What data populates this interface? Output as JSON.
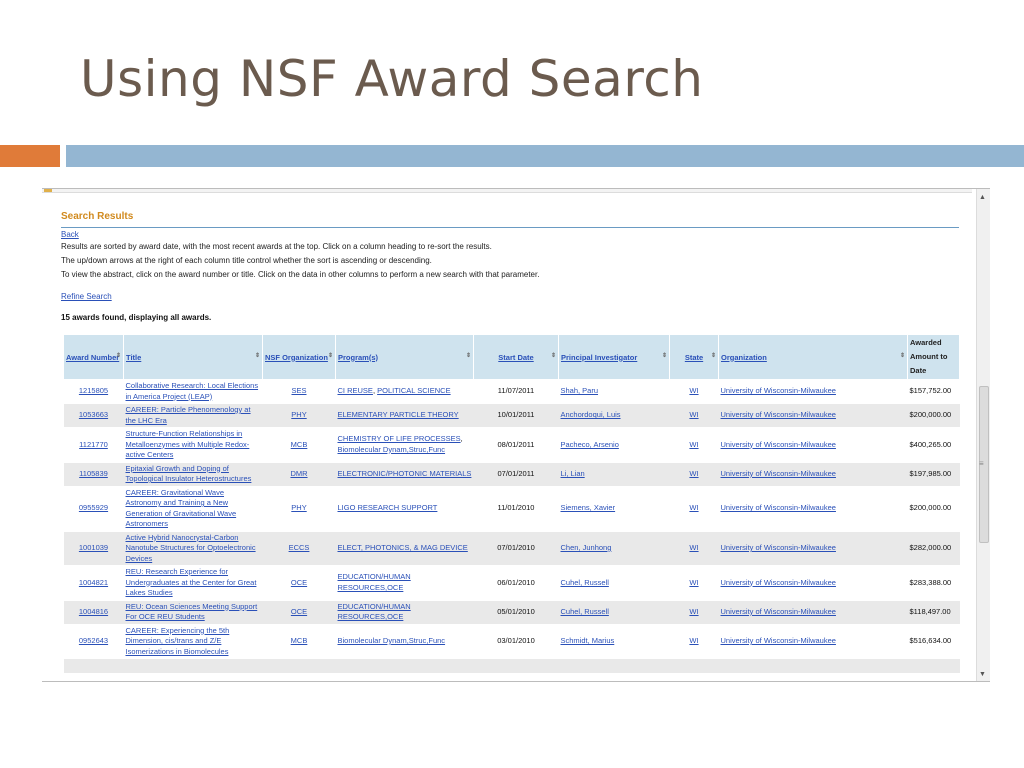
{
  "slide": {
    "title": "Using NSF Award Search"
  },
  "colors": {
    "title": "#6b5b4e",
    "accent_orange": "#e07b39",
    "accent_blue": "#94b6d2",
    "link": "#2a50b8",
    "heading": "#d18a1e"
  },
  "page": {
    "heading": "Search Results",
    "back_label": "Back",
    "info_lines": [
      "Results are sorted by award date, with the most recent awards at the top. Click on a column heading to re-sort the results.",
      "The up/down arrows at the right of each column title control whether the sort is ascending or descending.",
      "To view the abstract, click on the award number or title. Click on the data in other columns to perform a new search with that parameter."
    ],
    "refine_label": "Refine Search",
    "count_text": "15 awards found, displaying all awards."
  },
  "table": {
    "headers": [
      "Award Number",
      "Title",
      "NSF Organization",
      "Program(s)",
      "Start Date",
      "Principal Investigator",
      "State",
      "Organization",
      "Awarded Amount to Date"
    ],
    "rows": [
      {
        "award": "1215805",
        "title": "Collaborative Research: Local Elections in America Project (LEAP)",
        "org": "SES",
        "program_a": "CI REUSE",
        "sep": ", ",
        "program_b": "POLITICAL SCIENCE",
        "start": "11/07/2011",
        "pi": "Shah, Paru",
        "state": "WI",
        "institution": "University of Wisconsin-Milwaukee",
        "amount": "$157,752.00"
      },
      {
        "award": "1053663",
        "title": "CAREER: Particle Phenomenology at the LHC Era",
        "org": "PHY",
        "program_a": "ELEMENTARY PARTICLE THEORY",
        "sep": "",
        "program_b": "",
        "start": "10/01/2011",
        "pi": "Anchordoqui, Luis",
        "state": "WI",
        "institution": "University of Wisconsin-Milwaukee",
        "amount": "$200,000.00"
      },
      {
        "award": "1121770",
        "title": "Structure-Function Relationships in Metalloenzymes with Multiple Redox-active Centers",
        "org": "MCB",
        "program_a": "CHEMISTRY OF LIFE PROCESSES",
        "sep": ", ",
        "program_b": "Biomolecular Dynam,Struc,Func",
        "start": "08/01/2011",
        "pi": "Pacheco, Arsenio",
        "state": "WI",
        "institution": "University of Wisconsin-Milwaukee",
        "amount": "$400,265.00"
      },
      {
        "award": "1105839",
        "title": "Epitaxial Growth and Doping of Topological Insulator Heterostructures",
        "org": "DMR",
        "program_a": "ELECTRONIC/PHOTONIC MATERIALS",
        "sep": "",
        "program_b": "",
        "start": "07/01/2011",
        "pi": "Li, Lian",
        "state": "WI",
        "institution": "University of Wisconsin-Milwaukee",
        "amount": "$197,985.00"
      },
      {
        "award": "0955929",
        "title": "CAREER: Gravitational Wave Astronomy and Training a New Generation of Gravitational Wave Astronomers",
        "org": "PHY",
        "program_a": "LIGO RESEARCH SUPPORT",
        "sep": "",
        "program_b": "",
        "start": "11/01/2010",
        "pi": "Siemens, Xavier",
        "state": "WI",
        "institution": "University of Wisconsin-Milwaukee",
        "amount": "$200,000.00"
      },
      {
        "award": "1001039",
        "title": "Active Hybrid Nanocrystal-Carbon Nanotube Structures for Optoelectronic Devices",
        "org": "ECCS",
        "program_a": "ELECT, PHOTONICS, & MAG DEVICE",
        "sep": "",
        "program_b": "",
        "start": "07/01/2010",
        "pi": "Chen, Junhong",
        "state": "WI",
        "institution": "University of Wisconsin-Milwaukee",
        "amount": "$282,000.00"
      },
      {
        "award": "1004821",
        "title": "REU: Research Experience for Undergraduates at the Center for Great Lakes Studies",
        "org": "OCE",
        "program_a": "EDUCATION/HUMAN RESOURCES,OCE",
        "sep": "",
        "program_b": "",
        "start": "06/01/2010",
        "pi": "Cuhel, Russell",
        "state": "WI",
        "institution": "University of Wisconsin-Milwaukee",
        "amount": "$283,388.00"
      },
      {
        "award": "1004816",
        "title": "REU: Ocean Sciences Meeting Support For OCE REU Students",
        "org": "OCE",
        "program_a": "EDUCATION/HUMAN RESOURCES,OCE",
        "sep": "",
        "program_b": "",
        "start": "05/01/2010",
        "pi": "Cuhel, Russell",
        "state": "WI",
        "institution": "University of Wisconsin-Milwaukee",
        "amount": "$118,497.00"
      },
      {
        "award": "0952643",
        "title": "CAREER: Experiencing the 5th Dimension, cis/trans and Z/E Isomerizations in Biomolecules",
        "org": "MCB",
        "program_a": "Biomolecular Dynam,Struc,Func",
        "sep": "",
        "program_b": "",
        "start": "03/01/2010",
        "pi": "Schmidt, Marius",
        "state": "WI",
        "institution": "University of Wisconsin-Milwaukee",
        "amount": "$516,634.00"
      }
    ]
  },
  "icons": {
    "sort": "sort-arrows-icon",
    "scroll_up": "scroll-up-icon",
    "scroll_down": "scroll-down-icon",
    "grip": "scroll-grip-icon"
  }
}
